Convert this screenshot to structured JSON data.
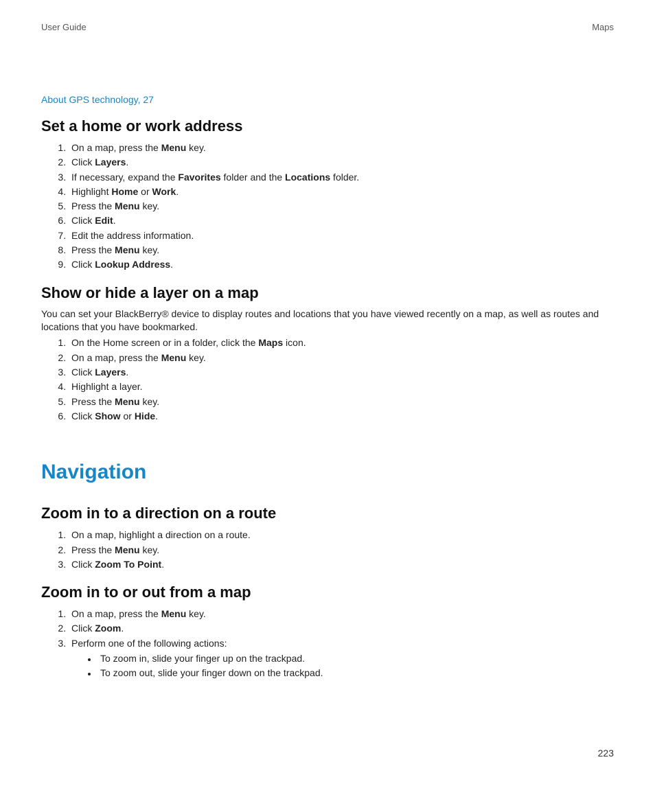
{
  "header": {
    "left": "User Guide",
    "right": "Maps"
  },
  "reflink": "About GPS technology, 27",
  "sec1": {
    "title": "Set a home or work address",
    "steps": [
      [
        {
          "t": "On a map, press the "
        },
        {
          "b": "Menu"
        },
        {
          "t": " key."
        }
      ],
      [
        {
          "t": "Click "
        },
        {
          "b": "Layers"
        },
        {
          "t": "."
        }
      ],
      [
        {
          "t": "If necessary, expand the "
        },
        {
          "b": "Favorites"
        },
        {
          "t": " folder and the "
        },
        {
          "b": "Locations"
        },
        {
          "t": " folder."
        }
      ],
      [
        {
          "t": "Highlight "
        },
        {
          "b": "Home"
        },
        {
          "t": " or "
        },
        {
          "b": "Work"
        },
        {
          "t": "."
        }
      ],
      [
        {
          "t": "Press the "
        },
        {
          "b": "Menu"
        },
        {
          "t": " key."
        }
      ],
      [
        {
          "t": "Click "
        },
        {
          "b": "Edit"
        },
        {
          "t": "."
        }
      ],
      [
        {
          "t": "Edit the address information."
        }
      ],
      [
        {
          "t": "Press the "
        },
        {
          "b": "Menu"
        },
        {
          "t": " key."
        }
      ],
      [
        {
          "t": "Click "
        },
        {
          "b": "Lookup Address"
        },
        {
          "t": "."
        }
      ]
    ]
  },
  "sec2": {
    "title": "Show or hide a layer on a map",
    "intro": "You can set your BlackBerry® device to display routes and locations that you have viewed recently on a map, as well as routes and locations that you have bookmarked.",
    "steps": [
      [
        {
          "t": "On the Home screen or in a folder, click the "
        },
        {
          "b": "Maps"
        },
        {
          "t": " icon."
        }
      ],
      [
        {
          "t": "On a map, press the "
        },
        {
          "b": "Menu"
        },
        {
          "t": " key."
        }
      ],
      [
        {
          "t": "Click "
        },
        {
          "b": "Layers"
        },
        {
          "t": "."
        }
      ],
      [
        {
          "t": "Highlight a layer."
        }
      ],
      [
        {
          "t": "Press the "
        },
        {
          "b": "Menu"
        },
        {
          "t": " key."
        }
      ],
      [
        {
          "t": "Click "
        },
        {
          "b": "Show"
        },
        {
          "t": " or "
        },
        {
          "b": "Hide"
        },
        {
          "t": "."
        }
      ]
    ]
  },
  "chapter": "Navigation",
  "sec3": {
    "title": "Zoom in to a direction on a route",
    "steps": [
      [
        {
          "t": "On a map, highlight a direction on a route."
        }
      ],
      [
        {
          "t": "Press the "
        },
        {
          "b": "Menu"
        },
        {
          "t": " key."
        }
      ],
      [
        {
          "t": "Click "
        },
        {
          "b": "Zoom To Point"
        },
        {
          "t": "."
        }
      ]
    ]
  },
  "sec4": {
    "title": "Zoom in to or out from a map",
    "steps": [
      [
        {
          "t": "On a map, press the "
        },
        {
          "b": "Menu"
        },
        {
          "t": " key."
        }
      ],
      [
        {
          "t": "Click "
        },
        {
          "b": "Zoom"
        },
        {
          "t": "."
        }
      ],
      [
        {
          "t": "Perform one of the following actions:"
        }
      ]
    ],
    "sub": [
      "To zoom in, slide your finger up on the trackpad.",
      "To zoom out, slide your finger down on the trackpad."
    ]
  },
  "pagenum": "223"
}
